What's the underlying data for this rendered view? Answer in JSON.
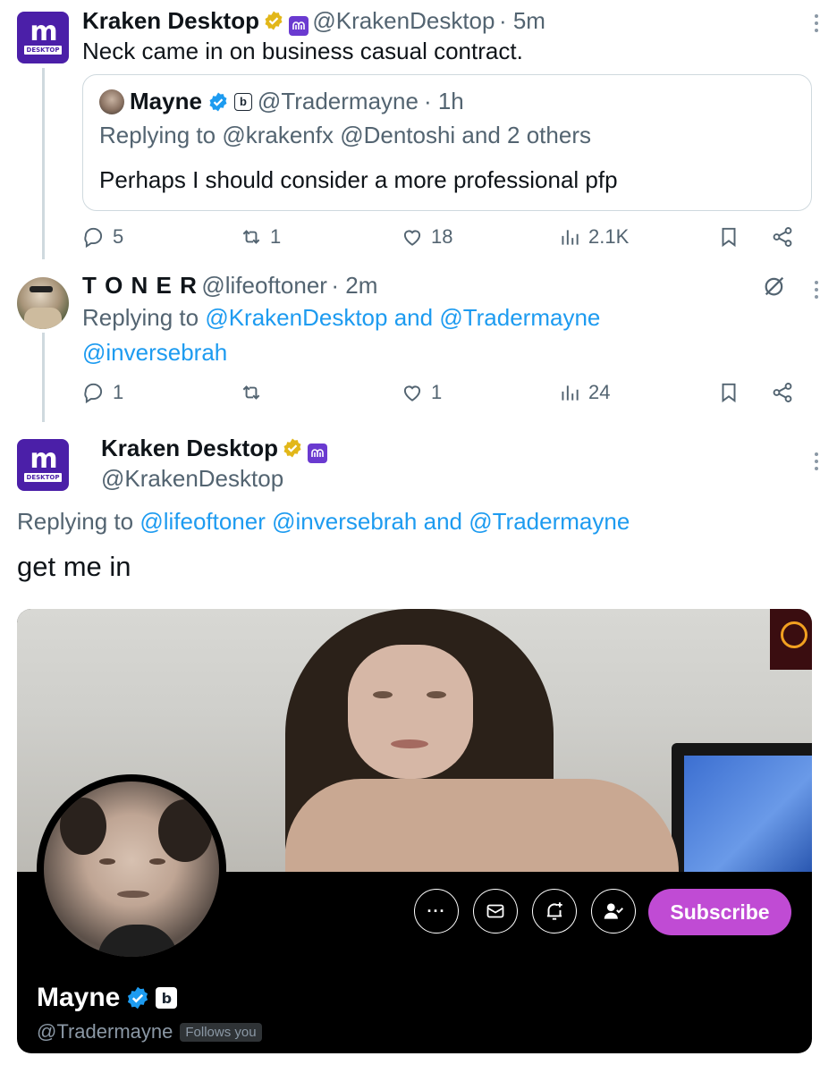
{
  "tweet1": {
    "name": "Kraken Desktop",
    "handle": "@KrakenDesktop",
    "time": "· 5m",
    "text": "Neck came in on business casual contract.",
    "avatar_text": "m",
    "avatar_tag": "DESKTOP",
    "quote": {
      "name": "Mayne",
      "handle": "@Tradermayne",
      "time": "· 1h",
      "replying_prefix": "Replying to",
      "replying_to": "@krakenfx @Dentoshi and 2 others",
      "text": "Perhaps I should consider a more professional pfp"
    },
    "actions": {
      "replies": "5",
      "reposts": "1",
      "likes": "18",
      "views": "2.1K"
    }
  },
  "tweet2": {
    "name": "T O N E R",
    "handle": "@lifeoftoner",
    "time": "· 2m",
    "replying_prefix": "Replying to",
    "replying_to_1": "@KrakenDesktop",
    "replying_and": "and",
    "replying_to_2": "@Tradermayne",
    "replying_to_3": "@inversebrah",
    "actions": {
      "replies": "1",
      "reposts": "",
      "likes": "1",
      "views": "24"
    }
  },
  "tweet3": {
    "name": "Kraken Desktop",
    "handle": "@KrakenDesktop",
    "replying_prefix": "Replying to",
    "replying_to_1": "@lifeoftoner",
    "replying_to_2": "@inversebrah",
    "replying_and": "and",
    "replying_to_3": "@Tradermayne",
    "text": "get me in",
    "avatar_text": "m",
    "avatar_tag": "DESKTOP"
  },
  "profile_card": {
    "name": "Mayne",
    "handle": "@Tradermayne",
    "follows_you": "Follows you",
    "subscribe": "Subscribe",
    "more": "···"
  },
  "icons": {
    "verified_gold": "verified-gold-badge-icon",
    "verified_blue": "verified-blue-badge-icon",
    "reply": "reply-icon",
    "repost": "repost-icon",
    "like": "heart-icon",
    "views": "views-icon",
    "bookmark": "bookmark-icon",
    "share": "share-icon",
    "more": "more-dots-icon",
    "grok": "grok-icon"
  },
  "colors": {
    "link": "#1d9bf0",
    "grey": "#536471",
    "kraken_purple": "#4b1fa8",
    "subscribe_bg": "#c04bd4",
    "gold": "#e2b719",
    "blue": "#1d9bf0"
  }
}
